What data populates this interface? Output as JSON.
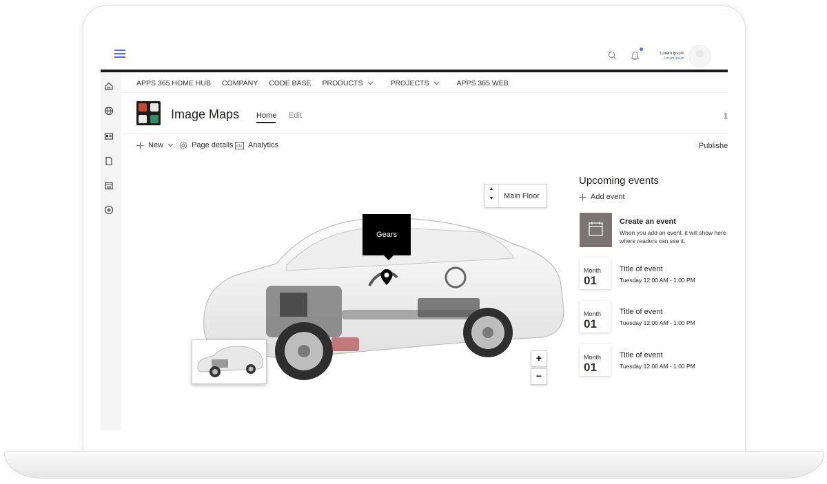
{
  "user": {
    "name": "Lorem ipsum",
    "subtitle": "Lorem ipsum"
  },
  "hub_nav": {
    "items": [
      {
        "label": "APPS 365 HOME HUB",
        "has_dropdown": false
      },
      {
        "label": "COMPANY",
        "has_dropdown": false
      },
      {
        "label": "CODE BASE",
        "has_dropdown": false
      },
      {
        "label": "PRODUCTS",
        "has_dropdown": true
      },
      {
        "label": "PROJECTS",
        "has_dropdown": true
      },
      {
        "label": "APPS 365 WEB",
        "has_dropdown": false
      }
    ]
  },
  "site": {
    "title": "Image Maps",
    "tabs": {
      "home": "Home",
      "edit": "Edit"
    },
    "right_indicator": "1"
  },
  "commands": {
    "new": "New",
    "page_details": "Page details",
    "analytics": "Analytics",
    "status": "Published"
  },
  "image_map": {
    "floor": "Main Floor",
    "tooltip": "Gears",
    "zoom_in": "+",
    "zoom_out": "−"
  },
  "events": {
    "title": "Upcoming events",
    "add_label": "Add event",
    "create": {
      "title": "Create an event",
      "description": "When you add an event, it will show here where readers can see it."
    },
    "items": [
      {
        "month": "Month",
        "day": "01",
        "title": "Title of event",
        "time": "Tuesday 12:00 AM - 1:00 PM"
      },
      {
        "month": "Month",
        "day": "01",
        "title": "Title of event",
        "time": "Tuesday 12:00 AM - 1:00 PM"
      },
      {
        "month": "Month",
        "day": "01",
        "title": "Title of event",
        "time": "Tuesday 12:00 AM - 1:00 PM"
      }
    ]
  },
  "colors": {
    "accent": "#4f6bed",
    "bar": "#1b1a19",
    "tile": "#7a7574"
  },
  "icons": [
    "menu-icon",
    "search-icon",
    "bell-icon",
    "home-icon",
    "globe-icon",
    "news-icon",
    "document-icon",
    "list-icon",
    "add-circle-icon",
    "plus-icon",
    "gear-icon",
    "analytics-icon",
    "calendar-icon",
    "map-pin-icon"
  ]
}
